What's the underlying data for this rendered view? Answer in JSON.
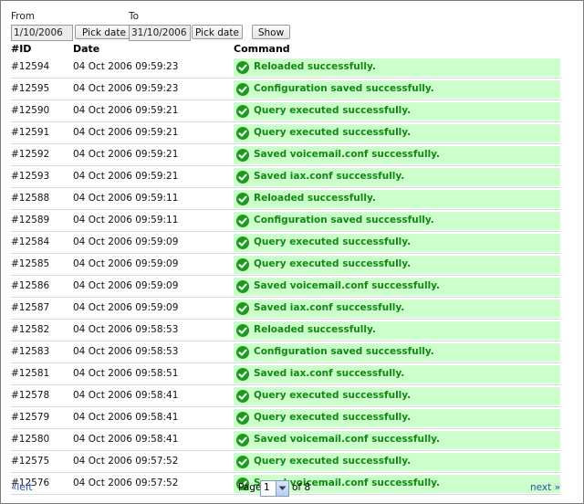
{
  "filter": {
    "from_label": "From",
    "to_label": "To",
    "from_value": "1/10/2006",
    "to_value": "31/10/2006",
    "pick_date_label": "Pick date",
    "show_label": "Show"
  },
  "table": {
    "headers": {
      "id": "#ID",
      "date": "Date",
      "command": "Command"
    },
    "rows": [
      {
        "id": "#12594",
        "date": "04 Oct 2006 09:59:23",
        "command": "Reloaded successfully."
      },
      {
        "id": "#12595",
        "date": "04 Oct 2006 09:59:23",
        "command": "Configuration saved successfully."
      },
      {
        "id": "#12590",
        "date": "04 Oct 2006 09:59:21",
        "command": "Query executed successfully."
      },
      {
        "id": "#12591",
        "date": "04 Oct 2006 09:59:21",
        "command": "Query executed successfully."
      },
      {
        "id": "#12592",
        "date": "04 Oct 2006 09:59:21",
        "command": "Saved voicemail.conf successfully."
      },
      {
        "id": "#12593",
        "date": "04 Oct 2006 09:59:21",
        "command": "Saved iax.conf successfully."
      },
      {
        "id": "#12588",
        "date": "04 Oct 2006 09:59:11",
        "command": "Reloaded successfully."
      },
      {
        "id": "#12589",
        "date": "04 Oct 2006 09:59:11",
        "command": "Configuration saved successfully."
      },
      {
        "id": "#12584",
        "date": "04 Oct 2006 09:59:09",
        "command": "Query executed successfully."
      },
      {
        "id": "#12585",
        "date": "04 Oct 2006 09:59:09",
        "command": "Query executed successfully."
      },
      {
        "id": "#12586",
        "date": "04 Oct 2006 09:59:09",
        "command": "Saved voicemail.conf successfully."
      },
      {
        "id": "#12587",
        "date": "04 Oct 2006 09:59:09",
        "command": "Saved iax.conf successfully."
      },
      {
        "id": "#12582",
        "date": "04 Oct 2006 09:58:53",
        "command": "Reloaded successfully."
      },
      {
        "id": "#12583",
        "date": "04 Oct 2006 09:58:53",
        "command": "Configuration saved successfully."
      },
      {
        "id": "#12581",
        "date": "04 Oct 2006 09:58:51",
        "command": "Saved iax.conf successfully."
      },
      {
        "id": "#12578",
        "date": "04 Oct 2006 09:58:41",
        "command": "Query executed successfully."
      },
      {
        "id": "#12579",
        "date": "04 Oct 2006 09:58:41",
        "command": "Query executed successfully."
      },
      {
        "id": "#12580",
        "date": "04 Oct 2006 09:58:41",
        "command": "Saved voicemail.conf successfully."
      },
      {
        "id": "#12575",
        "date": "04 Oct 2006 09:57:52",
        "command": "Query executed successfully."
      },
      {
        "id": "#12576",
        "date": "04 Oct 2006 09:57:52",
        "command": "Saved voicemail.conf successfully."
      }
    ]
  },
  "pager": {
    "prev_label": "«left",
    "next_label": "next »",
    "page_label": "Page",
    "current_page": "1",
    "of_label": "of 8"
  },
  "icons": {
    "status": "check-circle-icon",
    "select_arrow": "chevron-down-icon"
  },
  "colors": {
    "success_bg": "#ccffcc",
    "success_text": "#0f8a0f",
    "success_icon": "#1e9a1e",
    "link": "#2255aa"
  }
}
